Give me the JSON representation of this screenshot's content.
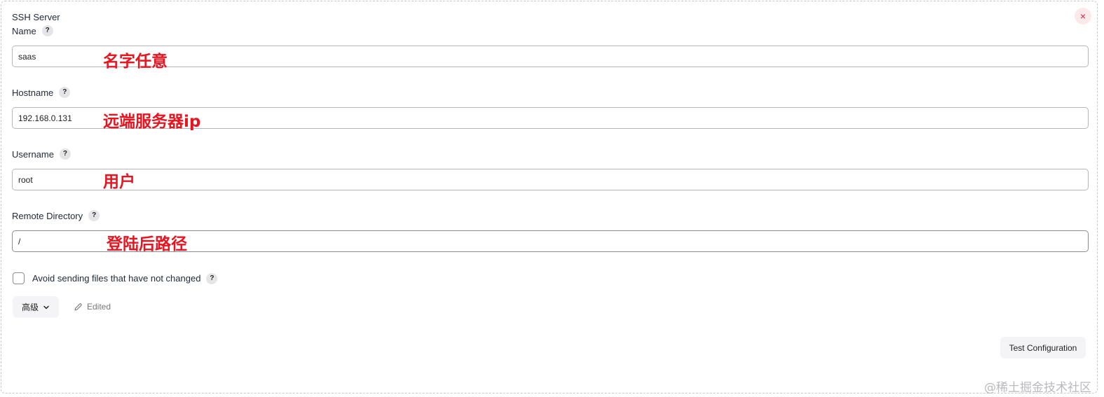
{
  "section": {
    "title": "SSH Server",
    "close_icon": "×"
  },
  "fields": {
    "name": {
      "label": "Name",
      "help": "?",
      "value": "saas",
      "annotation": "名字任意"
    },
    "hostname": {
      "label": "Hostname",
      "help": "?",
      "value": "192.168.0.131",
      "annotation": "远端服务器ip"
    },
    "username": {
      "label": "Username",
      "help": "?",
      "value": "root",
      "annotation": "用户"
    },
    "remote_directory": {
      "label": "Remote Directory",
      "help": "?",
      "value": "/",
      "annotation": "登陆后路径"
    }
  },
  "options": {
    "avoid_sending": {
      "label": "Avoid sending files that have not changed",
      "help": "?",
      "checked": false
    }
  },
  "actions": {
    "advanced_label": "高级",
    "edited_label": "Edited",
    "test_label": "Test Configuration"
  },
  "watermark": "@稀土掘金技术社区",
  "colors": {
    "annotation": "#e8141f",
    "close": "#d2233b"
  }
}
